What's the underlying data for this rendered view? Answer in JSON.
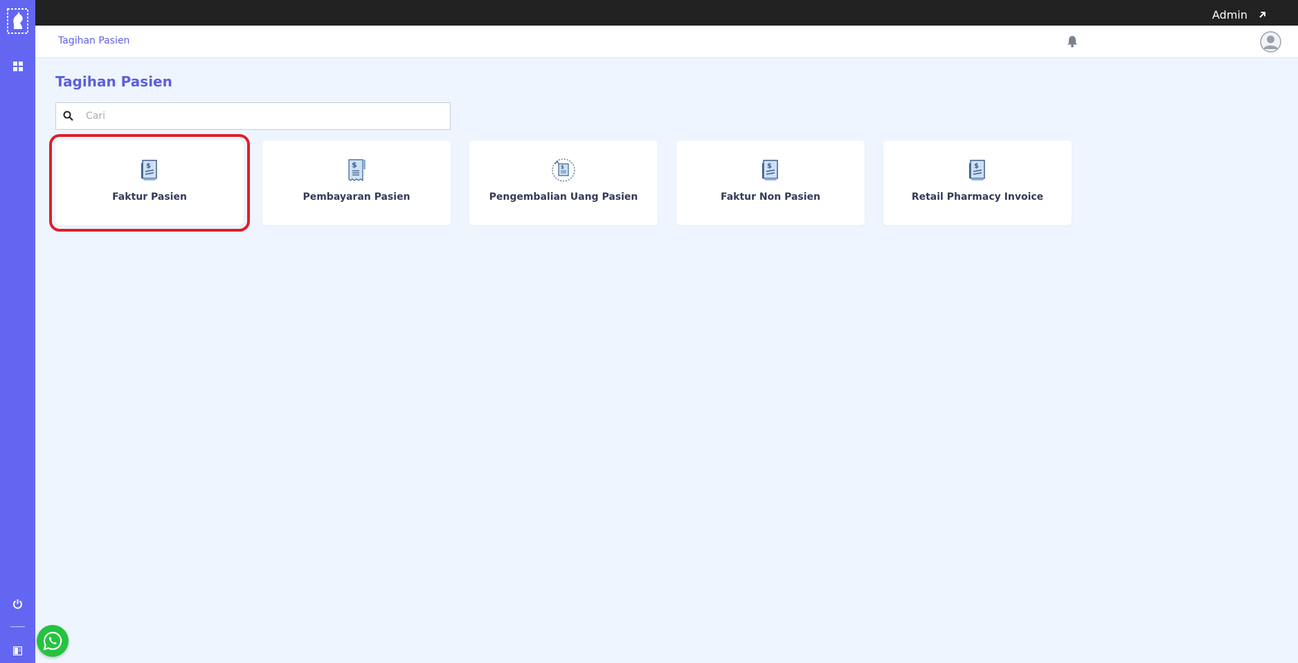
{
  "topbar": {
    "user_label": "Admin"
  },
  "header": {
    "breadcrumb": "Tagihan Pasien"
  },
  "main": {
    "title": "Tagihan Pasien",
    "search": {
      "placeholder": "Cari",
      "value": ""
    },
    "cards": [
      {
        "label": "Faktur Pasien",
        "icon": "invoice-icon",
        "selected": true
      },
      {
        "label": "Pembayaran Pasien",
        "icon": "receipt-icon",
        "selected": false
      },
      {
        "label": "Pengembalian Uang Pasien",
        "icon": "refund-icon",
        "selected": false
      },
      {
        "label": "Faktur Non Pasien",
        "icon": "invoice-icon",
        "selected": false
      },
      {
        "label": "Retail Pharmacy Invoice",
        "icon": "invoice-icon",
        "selected": false
      }
    ]
  },
  "colors": {
    "sidebar": "#6366f1",
    "accent": "#5b5fe0",
    "topbar": "#222222",
    "highlight": "#e11d26",
    "background": "#eef5fe"
  }
}
